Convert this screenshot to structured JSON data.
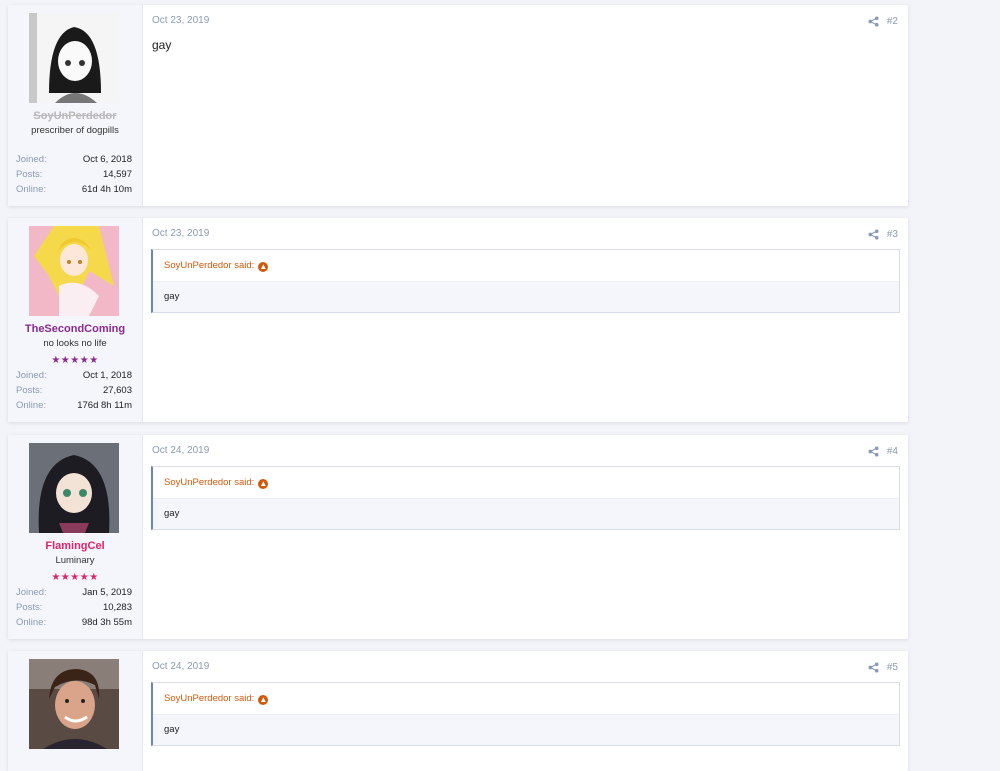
{
  "posts": [
    {
      "user": {
        "name": "SoyUnPerdedor",
        "title": "prescriber of dogpills",
        "stars": "",
        "name_color": "#b9b9b9",
        "stats": [
          {
            "key": "Joined:",
            "value": "Oct 6, 2018"
          },
          {
            "key": "Posts:",
            "value": "14,597"
          },
          {
            "key": "Online:",
            "value": "61d 4h 10m"
          }
        ]
      },
      "date": "Oct 23, 2019",
      "number": "#2",
      "body": "gay"
    },
    {
      "user": {
        "name": "TheSecondComing",
        "title": "no looks no life",
        "stars": "★★★★★",
        "name_color": "#8a2a8f",
        "stars_color": "#8a2a8f",
        "stats": [
          {
            "key": "Joined:",
            "value": "Oct 1, 2018"
          },
          {
            "key": "Posts:",
            "value": "27,603"
          },
          {
            "key": "Online:",
            "value": "176d 8h 11m"
          }
        ]
      },
      "date": "Oct 23, 2019",
      "number": "#3",
      "quote": {
        "author": "SoyUnPerdedor said:",
        "text": "gay"
      }
    },
    {
      "user": {
        "name": "FlamingCel",
        "title": "Luminary",
        "stars": "★★★★★",
        "name_color": "#e0246b",
        "stars_color": "#e0246b",
        "stats": [
          {
            "key": "Joined:",
            "value": "Jan 5, 2019"
          },
          {
            "key": "Posts:",
            "value": "10,283"
          },
          {
            "key": "Online:",
            "value": "98d 3h 55m"
          }
        ]
      },
      "date": "Oct 24, 2019",
      "number": "#4",
      "quote": {
        "author": "SoyUnPerdedor said:",
        "text": "gay"
      }
    },
    {
      "user": {
        "name": "",
        "title": "",
        "stars": "",
        "stats": []
      },
      "date": "Oct 24, 2019",
      "number": "#5",
      "quote": {
        "author": "SoyUnPerdedor said:",
        "text": "gay"
      }
    }
  ],
  "icons": {
    "share": "share-icon",
    "quote_jump": "arrow-up-circle-icon"
  },
  "colors": {
    "accent": "#6c85b8",
    "quote_author": "#d05a0c",
    "muted": "#8a9bb5"
  }
}
